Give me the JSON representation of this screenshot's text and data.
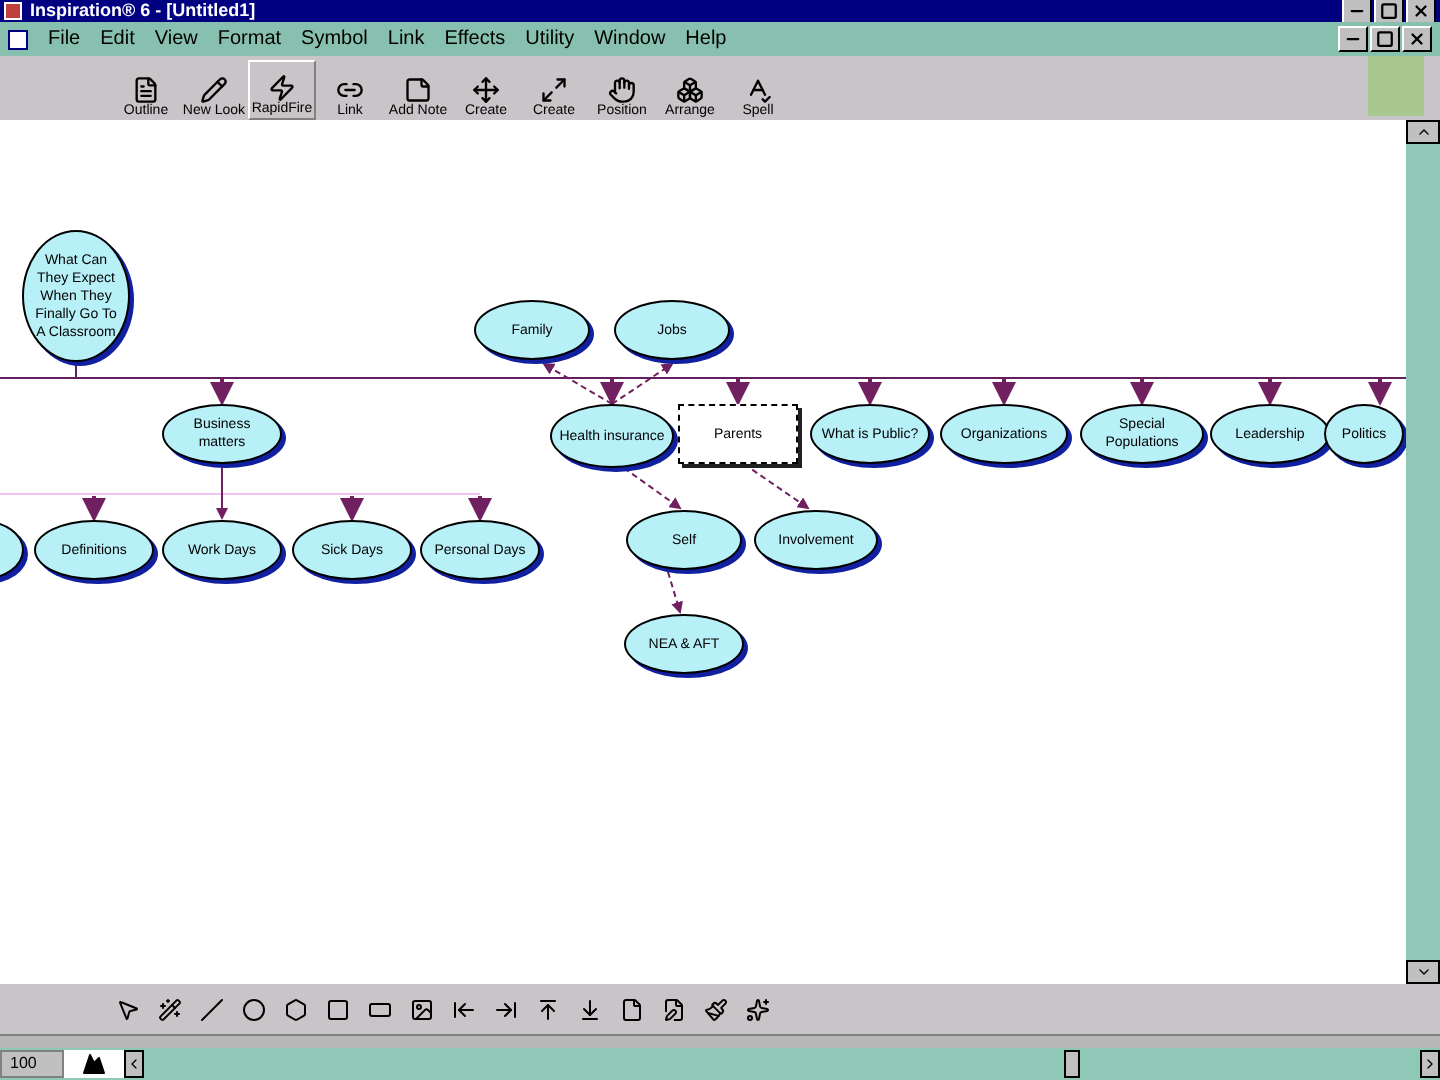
{
  "window": {
    "title": "Inspiration® 6 - [Untitled1]"
  },
  "menu": [
    "File",
    "Edit",
    "View",
    "Format",
    "Symbol",
    "Link",
    "Effects",
    "Utility",
    "Window",
    "Help"
  ],
  "toolbar": [
    "Outline",
    "New Look",
    "RapidFire",
    "Link",
    "Add Note",
    "Create",
    "Create",
    "Position",
    "Arrange",
    "Spell"
  ],
  "diagram": {
    "nodes": [
      {
        "text": "What Can They Expect When They Finally Go To A Classroom",
        "selected": false
      },
      {
        "text": "Family",
        "selected": false
      },
      {
        "text": "Jobs",
        "selected": false
      },
      {
        "text": "Business matters",
        "selected": false
      },
      {
        "text": "Health insurance",
        "selected": false
      },
      {
        "text": "Parents",
        "selected": true
      },
      {
        "text": "What is Public?",
        "selected": false
      },
      {
        "text": "Organizations",
        "selected": false
      },
      {
        "text": "Special Populations",
        "selected": false
      },
      {
        "text": "Leadership",
        "selected": false
      },
      {
        "text": "Politics",
        "selected": false
      },
      {
        "text": "Definitions",
        "selected": false
      },
      {
        "text": "Work Days",
        "selected": false
      },
      {
        "text": "Sick Days",
        "selected": false
      },
      {
        "text": "Personal Days",
        "selected": false
      },
      {
        "text": "Self",
        "selected": false
      },
      {
        "text": "Involvement",
        "selected": false
      },
      {
        "text": "NEA & AFT",
        "selected": false
      }
    ]
  },
  "status_bar": {
    "zoom": "100"
  }
}
